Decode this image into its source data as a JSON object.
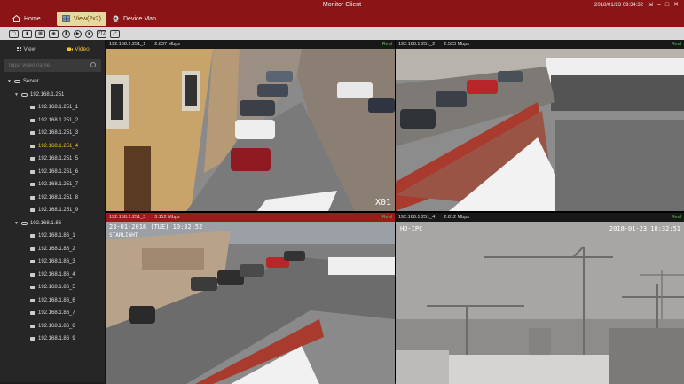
{
  "app": {
    "title": "Monitor Client",
    "datetime": "2018/01/23 09:34:32"
  },
  "nav": {
    "home": "Home",
    "view": "View(2x2)",
    "device": "Device Man"
  },
  "toolbar": {
    "ptz_label": "PTZ"
  },
  "sidebar": {
    "tab_view": "View",
    "tab_video": "Video",
    "search_placeholder": "Input video name",
    "root": "Server",
    "server1": "192.168.1.251",
    "server1_channels": [
      "192.168.1.251_1",
      "192.168.1.251_2",
      "192.168.1.251_3",
      "192.168.1.251_4",
      "192.168.1.251_5",
      "192.168.1.251_6",
      "192.168.1.251_7",
      "192.168.1.251_8",
      "192.168.1.251_9"
    ],
    "server2": "192.168.1.86",
    "server2_channels": [
      "192.168.1.86_1",
      "192.168.1.86_2",
      "192.168.1.86_3",
      "192.168.1.86_4",
      "192.168.1.86_5",
      "192.168.1.86_6",
      "192.168.1.86_7",
      "192.168.1.86_8",
      "192.168.1.86_9"
    ],
    "selected_channel": "192.168.1.251_4"
  },
  "panes": [
    {
      "channel": "192.168.1.251_1",
      "bitrate": "2.837 Mbps",
      "status": "Real",
      "overlay": "X01"
    },
    {
      "channel": "192.168.1.251_2",
      "bitrate": "2.523 Mbps",
      "status": "Real"
    },
    {
      "channel": "192.168.1.251_3",
      "bitrate": "3.112 Mbps",
      "status": "Real",
      "overlay": "23-01-2018 (TUE) 10:32:52",
      "overlay2": "STARLIGHT"
    },
    {
      "channel": "192.168.1.251_4",
      "bitrate": "2.812 Mbps",
      "status": "Real",
      "overlay": "HD-IPC",
      "overlay2": "2018-01-23  10:32:51"
    }
  ],
  "colors": {
    "titlebar": "#8b1516",
    "accent": "#f0c430",
    "real_status": "#4fc24f"
  }
}
